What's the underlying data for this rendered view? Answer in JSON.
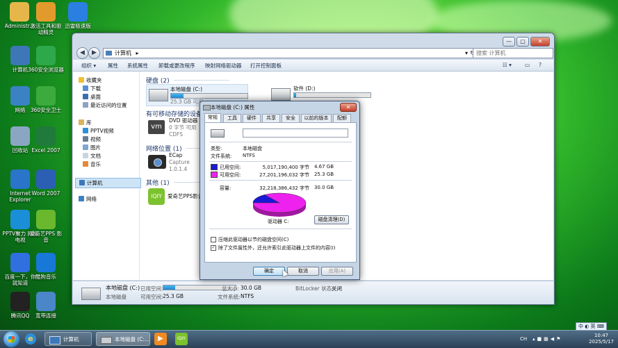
{
  "desktop": {
    "icons": [
      {
        "label": "Administr...",
        "icon": "user-folder-icon",
        "color": "#e7b64b"
      },
      {
        "label": "激活工具和驱动精灵",
        "icon": "tool-folder-icon",
        "color": "#e39a2c"
      },
      {
        "label": "迅雷极速版",
        "icon": "thunder-icon",
        "color": "#2b7fe0"
      },
      {
        "label": "计算机",
        "icon": "computer-icon",
        "color": "#3d77b8"
      },
      {
        "label": "360安全浏览器",
        "icon": "browser-360-icon",
        "color": "#2da84a"
      },
      {
        "label": "网络",
        "icon": "network-icon",
        "color": "#3b82c4"
      },
      {
        "label": "360安全卫士",
        "icon": "guard-360-icon",
        "color": "#3caa3c"
      },
      {
        "label": "回收站",
        "icon": "recycle-bin-icon",
        "color": "#8aa6c2"
      },
      {
        "label": "Excel 2007",
        "icon": "excel-icon",
        "color": "#1f7a3c"
      },
      {
        "label": "Internet Explorer",
        "icon": "ie-icon",
        "color": "#2a74c9"
      },
      {
        "label": "Word 2007",
        "icon": "word-icon",
        "color": "#2b5fb4"
      },
      {
        "label": "PPTV聚力 网络电视",
        "icon": "pptv-icon",
        "color": "#1a8fd8"
      },
      {
        "label": "爱奇艺PPS 影音",
        "icon": "iqiyi-icon",
        "color": "#6ab82e"
      },
      {
        "label": "百度一下，你就知道",
        "icon": "baidu-icon",
        "color": "#2f6fe0"
      },
      {
        "label": "酷狗音乐",
        "icon": "kugou-icon",
        "color": "#1878d8"
      },
      {
        "label": "腾讯QQ",
        "icon": "qq-icon",
        "color": "#222222"
      },
      {
        "label": "宽带连接",
        "icon": "broadband-icon",
        "color": "#4a86c8"
      }
    ]
  },
  "explorer": {
    "address": [
      "计算机",
      "▸"
    ],
    "search_placeholder": "搜索 计算机",
    "toolbar": [
      "组织 ▾",
      "属性",
      "系统属性",
      "卸载或更改程序",
      "映射网络驱动器",
      "打开控制面板"
    ],
    "nav": {
      "favorites": "收藏夹",
      "fav_items": [
        "下载",
        "桌面",
        "最近访问的位置"
      ],
      "libraries": "库",
      "lib_items": [
        "PPTV视频",
        "视频",
        "图片",
        "文档",
        "音乐"
      ],
      "computer": "计算机",
      "network": "网络"
    },
    "groups": {
      "hard_disk": "硬盘 (2)",
      "removable": "有可移动存储的设备",
      "network_location": "网络位置 (1)",
      "other": "其他 (1)"
    },
    "drives": [
      {
        "name": "本地磁盘 (C:)",
        "free": "25.3 GB 可用",
        "used_fraction": 0.16
      },
      {
        "name": "软件 (D:)",
        "free": "",
        "used_fraction": 0.03
      }
    ],
    "dvd": {
      "name": "DVD 驱动器 (E",
      "line2": "0 字节 可用",
      "line3": "CDFS"
    },
    "ecap": {
      "name": "ECap",
      "line2": "Capture",
      "line3": "1.0.1.4"
    },
    "other_item": "爱奇艺PPS影音",
    "details": {
      "name": "本地磁盘 (C:)",
      "type": "本地磁盘",
      "used_label": "已用空间:",
      "used_fraction": 0.16,
      "free_label": "可用空间:",
      "free_value": "25.3 GB",
      "total_label": "总大小:",
      "total_value": "30.0 GB",
      "fs_label": "文件系统:",
      "fs_value": "NTFS",
      "bitlocker_label": "BitLocker 状态:",
      "bitlocker_value": "关闭"
    }
  },
  "dialog": {
    "title": "本地磁盘 (C:) 属性",
    "close": "✕",
    "tabs": [
      "常规",
      "工具",
      "硬件",
      "共享",
      "安全",
      "以前的版本",
      "配额"
    ],
    "type_label": "类型:",
    "type_value": "本地磁盘",
    "fs_label": "文件系统:",
    "fs_value": "NTFS",
    "used_label": "已用空间:",
    "used_bytes": "5,017,190,400 字节",
    "used_gb": "4.67 GB",
    "free_label": "可用空间:",
    "free_bytes": "27,201,196,032 字节",
    "free_gb": "25.3 GB",
    "capacity_label": "容量:",
    "capacity_bytes": "32,218,386,432 字节",
    "capacity_gb": "30.0 GB",
    "drive_label": "驱动器 C:",
    "cleanup": "磁盘清理(D)",
    "compress": "压缩此驱动器以节约磁盘空间(C)",
    "index": "除了文件属性外，还允许索引此驱动器上文件的内容(I)",
    "ok": "确定",
    "cancel": "取消",
    "apply": "应用(A)",
    "used_color": "#1a1ad6",
    "free_color": "#ee22ee",
    "used_fraction": 0.156
  },
  "taskbar": {
    "items": [
      "计算机",
      "本地磁盘 (C:..."
    ],
    "lang": "CH",
    "time": "10:47",
    "date": "2025/5/17",
    "ime": "中 ◐ 英 ⌨"
  }
}
